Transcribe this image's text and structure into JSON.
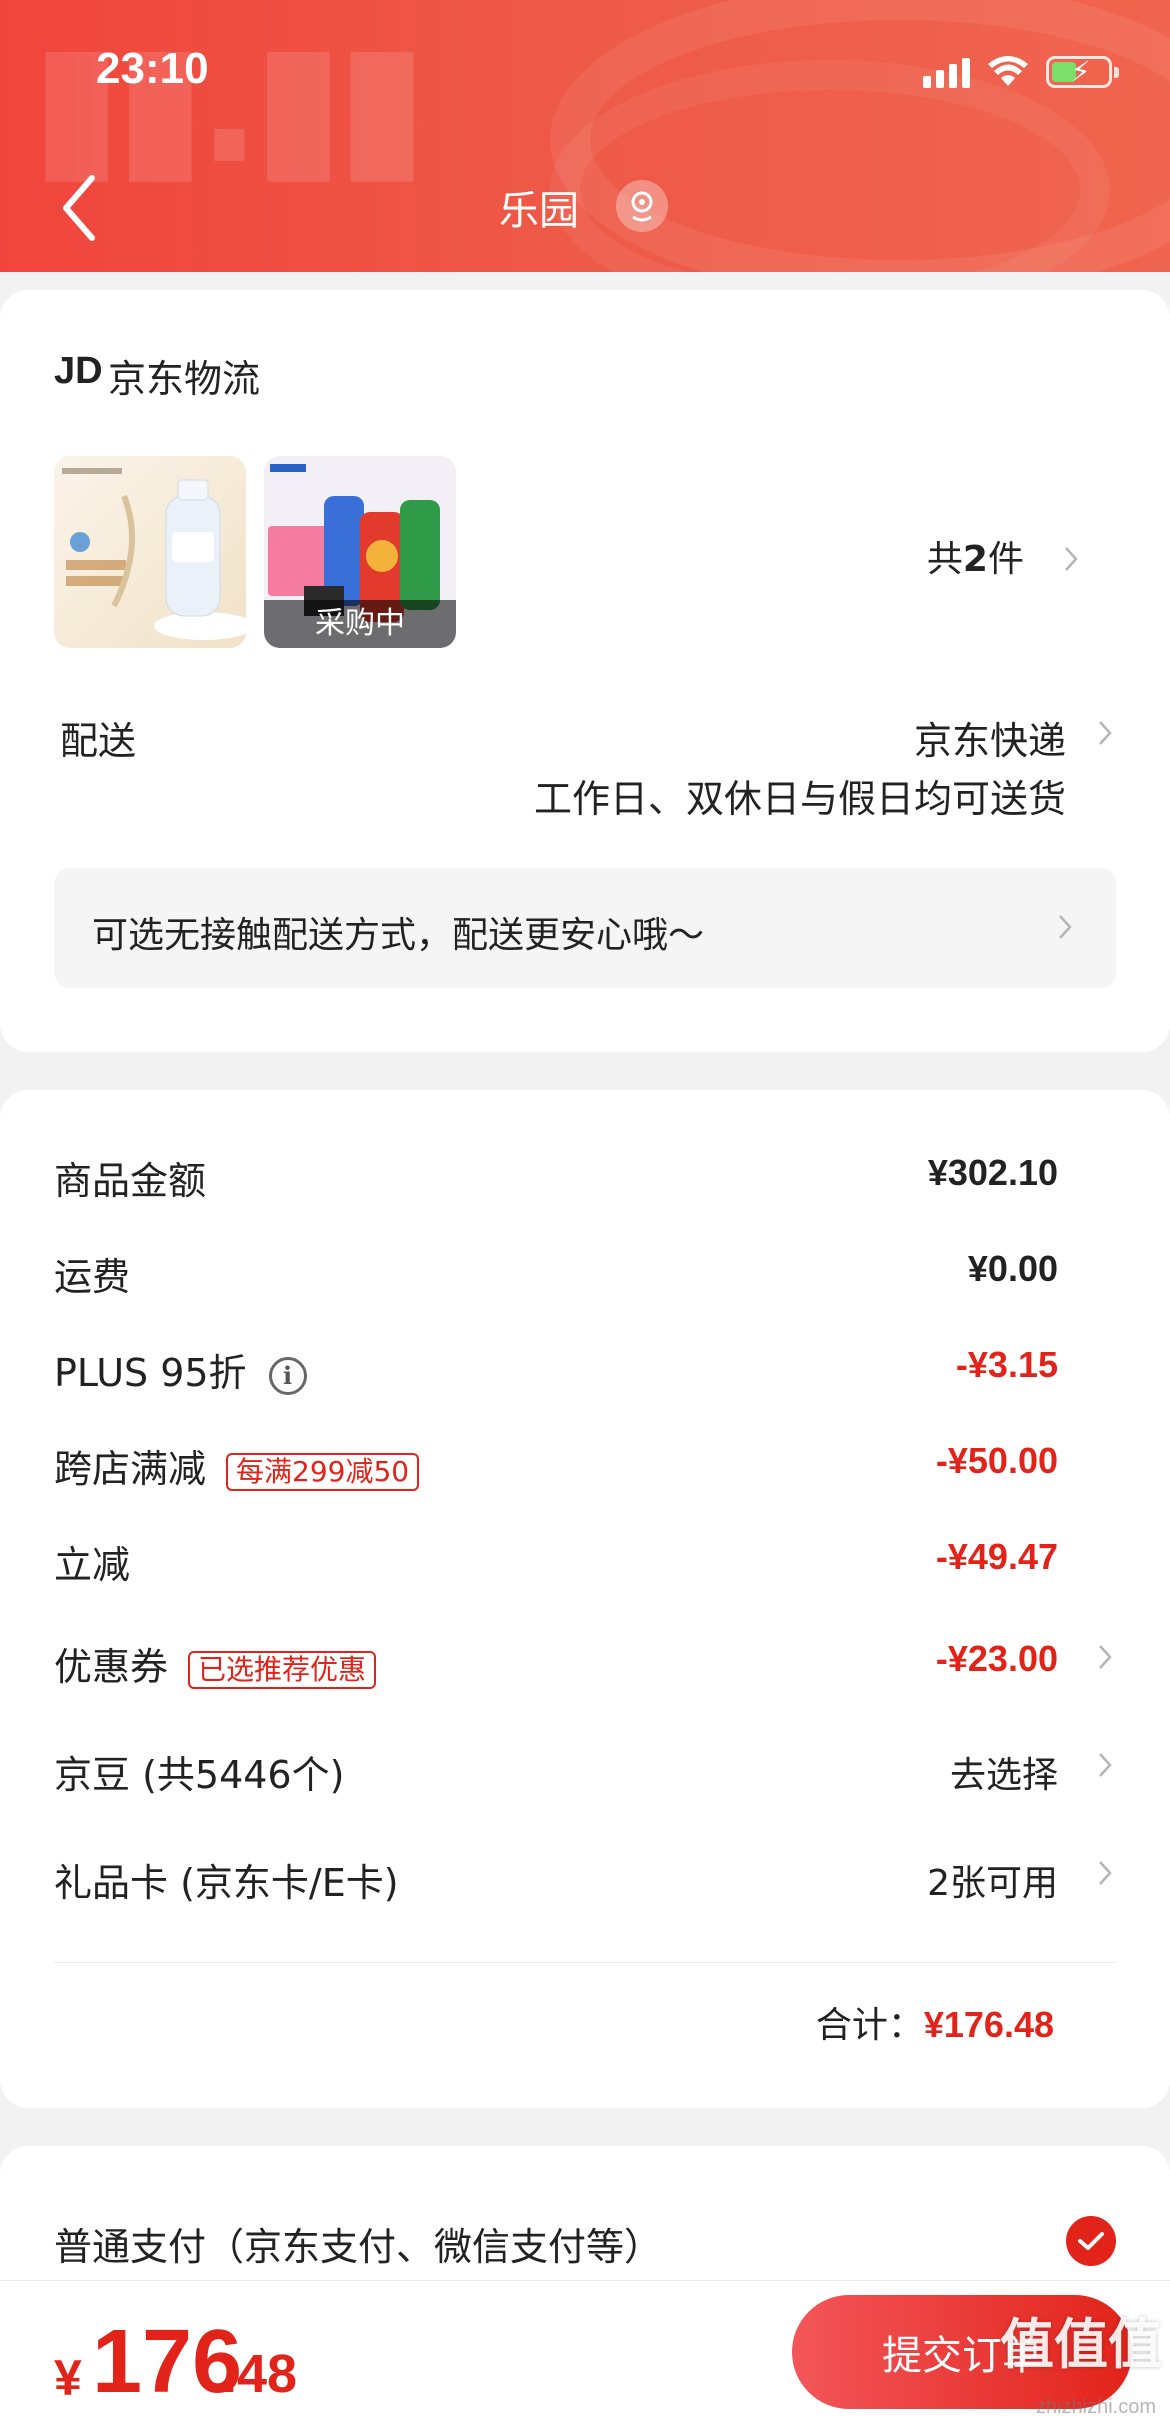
{
  "status_bar": {
    "time": "23:10"
  },
  "header": {
    "title": "乐园"
  },
  "shipping": {
    "logo": "JD",
    "label": "京东物流",
    "thumb_overlay": "采购中",
    "count_prefix": "共",
    "count": "2",
    "count_suffix": "件",
    "delivery_label": "配送",
    "delivery_value": "京东快递",
    "delivery_sub": "工作日、双休日与假日均可送货",
    "notice": "可选无接触配送方式，配送更安心哦～"
  },
  "summary": {
    "rows": [
      {
        "label": "商品金额",
        "value": "¥302.10"
      },
      {
        "label": "运费",
        "value": "¥0.00"
      },
      {
        "label": "PLUS 95折",
        "value": "-¥3.15"
      },
      {
        "label": "跨店满减",
        "tag": "每满299减50",
        "value": "-¥50.00"
      },
      {
        "label": "立减",
        "value": "-¥49.47"
      },
      {
        "label": "优惠券",
        "tag": "已选推荐优惠",
        "value": "-¥23.00"
      },
      {
        "label": "京豆 (共5446个)",
        "value": "去选择"
      },
      {
        "label": "礼品卡 (京东卡/E卡)",
        "value": "2张可用"
      }
    ],
    "total_label": "合计：",
    "total_value": "¥176.48"
  },
  "payment": {
    "label": "普通支付（京东支付、微信支付等）"
  },
  "bottom": {
    "yen": "¥",
    "price_int": "176",
    "price_dec": ".48",
    "submit_label": "提交订单"
  },
  "watermark": {
    "text": "值值值",
    "sub": "zhizhizhi.com"
  },
  "colors": {
    "accent": "#e2231a",
    "header": "#ef4d40"
  }
}
